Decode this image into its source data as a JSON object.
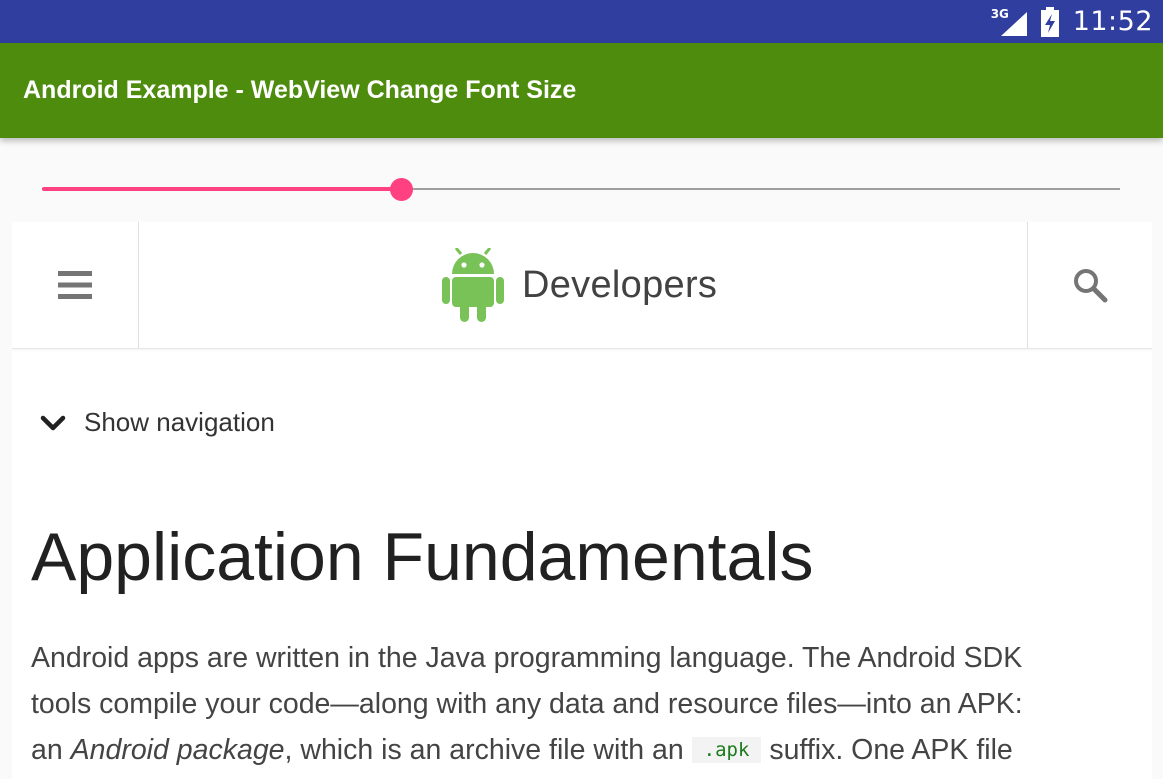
{
  "status_bar": {
    "network": "3G",
    "time": "11:52"
  },
  "app_bar": {
    "title": "Android Example - WebView Change Font Size"
  },
  "font_slider": {
    "value_fraction": 0.333,
    "accent_color": "#ff4081"
  },
  "site_header": {
    "brand": "Developers",
    "menu_icon": "hamburger-menu-icon",
    "search_icon": "search-icon",
    "logo_icon": "android-robot-icon",
    "logo_color": "#78c257"
  },
  "navigation": {
    "toggle_label": "Show navigation"
  },
  "article": {
    "title": "Application Fundamentals",
    "line1": "Android apps are written in the Java programming language. The Android SDK",
    "line2": "tools compile your code—along with any data and resource files—into an APK:",
    "line3_pre": "an ",
    "line3_em": "Android package",
    "line3_mid": ", which is an archive file with an ",
    "line3_code": ".apk",
    "line3_post": " suffix. One APK file"
  },
  "colors": {
    "status_bar": "#303f9f",
    "app_bar": "#4e8c0e"
  }
}
